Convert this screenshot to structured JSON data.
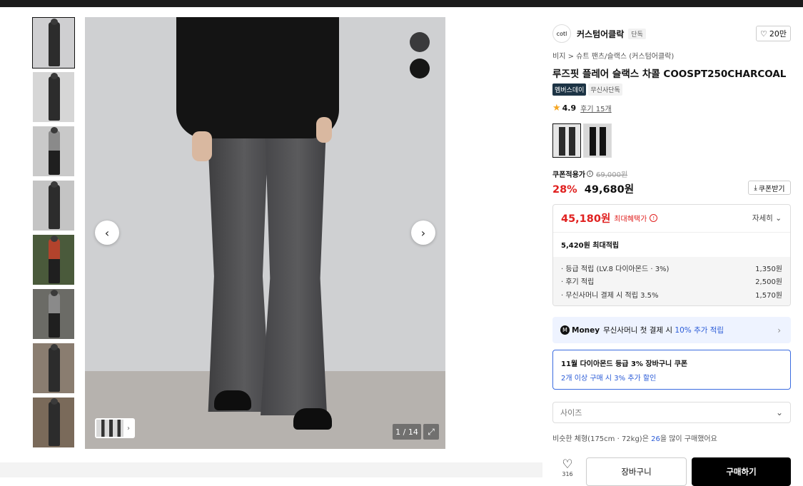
{
  "gallery": {
    "thumbnails": [
      {
        "bg": "#cfcfd1",
        "figure": "dark"
      },
      {
        "bg": "#d6d6d6",
        "figure": "dark"
      },
      {
        "bg": "#c9c9c9",
        "figure": "grey"
      },
      {
        "bg": "#c4c4c4",
        "figure": "dark"
      },
      {
        "bg": "#4a5a3b",
        "figure": "red"
      },
      {
        "bg": "#6b6b66",
        "figure": "grey"
      },
      {
        "bg": "#8a7d70",
        "figure": "dark"
      },
      {
        "bg": "#7a6a5a",
        "figure": "dark"
      }
    ],
    "counter": "1 / 14",
    "swatch_colors": [
      "#3a3a3c",
      "#161616"
    ]
  },
  "product": {
    "brand_logo": "cotl",
    "brand_name": "커스텀어클락",
    "brand_tag": "단독",
    "like_count": "20만",
    "breadcrumb": "비지 > 슈트 팬츠/슬랙스 (커스텀어클락)",
    "title": "루즈핏 플레어 슬랙스 차콜 COOSPT250CHARCOAL",
    "badge_member": "멤버스데이",
    "badge_exclusive": "무신사단독",
    "rating": "4.9",
    "reviews": "후기 15개",
    "coupon_label": "쿠폰적용가",
    "original_price": "69,000원",
    "discount": "28%",
    "price": "49,680원",
    "coupon_button": "쿠폰받기"
  },
  "benefits": {
    "max_price": "45,180원",
    "max_label": "최대혜택가",
    "detail": "자세히",
    "points_total": "5,420원 최대적립",
    "items": [
      {
        "label": "· 등급 적립 (LV.8 다이아몬드 · 3%)",
        "value": "1,350원"
      },
      {
        "label": "· 후기 적립",
        "value": "2,500원"
      },
      {
        "label": "· 무신사머니 결제 시 적립 3.5%",
        "value": "1,570원"
      }
    ]
  },
  "money_banner": {
    "icon": "M",
    "name": "Money",
    "text": "무신사머니 첫 결제 시",
    "highlight": "10% 추가 적립"
  },
  "cart_coupon": {
    "line1": "11월 다이아몬드 등급 3% 장바구니 쿠폰",
    "line2": "2개 이상 구매 시 3% 추가 할인"
  },
  "size_select": {
    "placeholder": "사이즈"
  },
  "similar": {
    "prefix": "비슷한 체형(175cm · 72kg)은",
    "count": "26",
    "suffix": "을 많이 구매했어요"
  },
  "actions": {
    "wish_count": "316",
    "cart_label": "장바구니",
    "buy_label": "구매하기"
  }
}
